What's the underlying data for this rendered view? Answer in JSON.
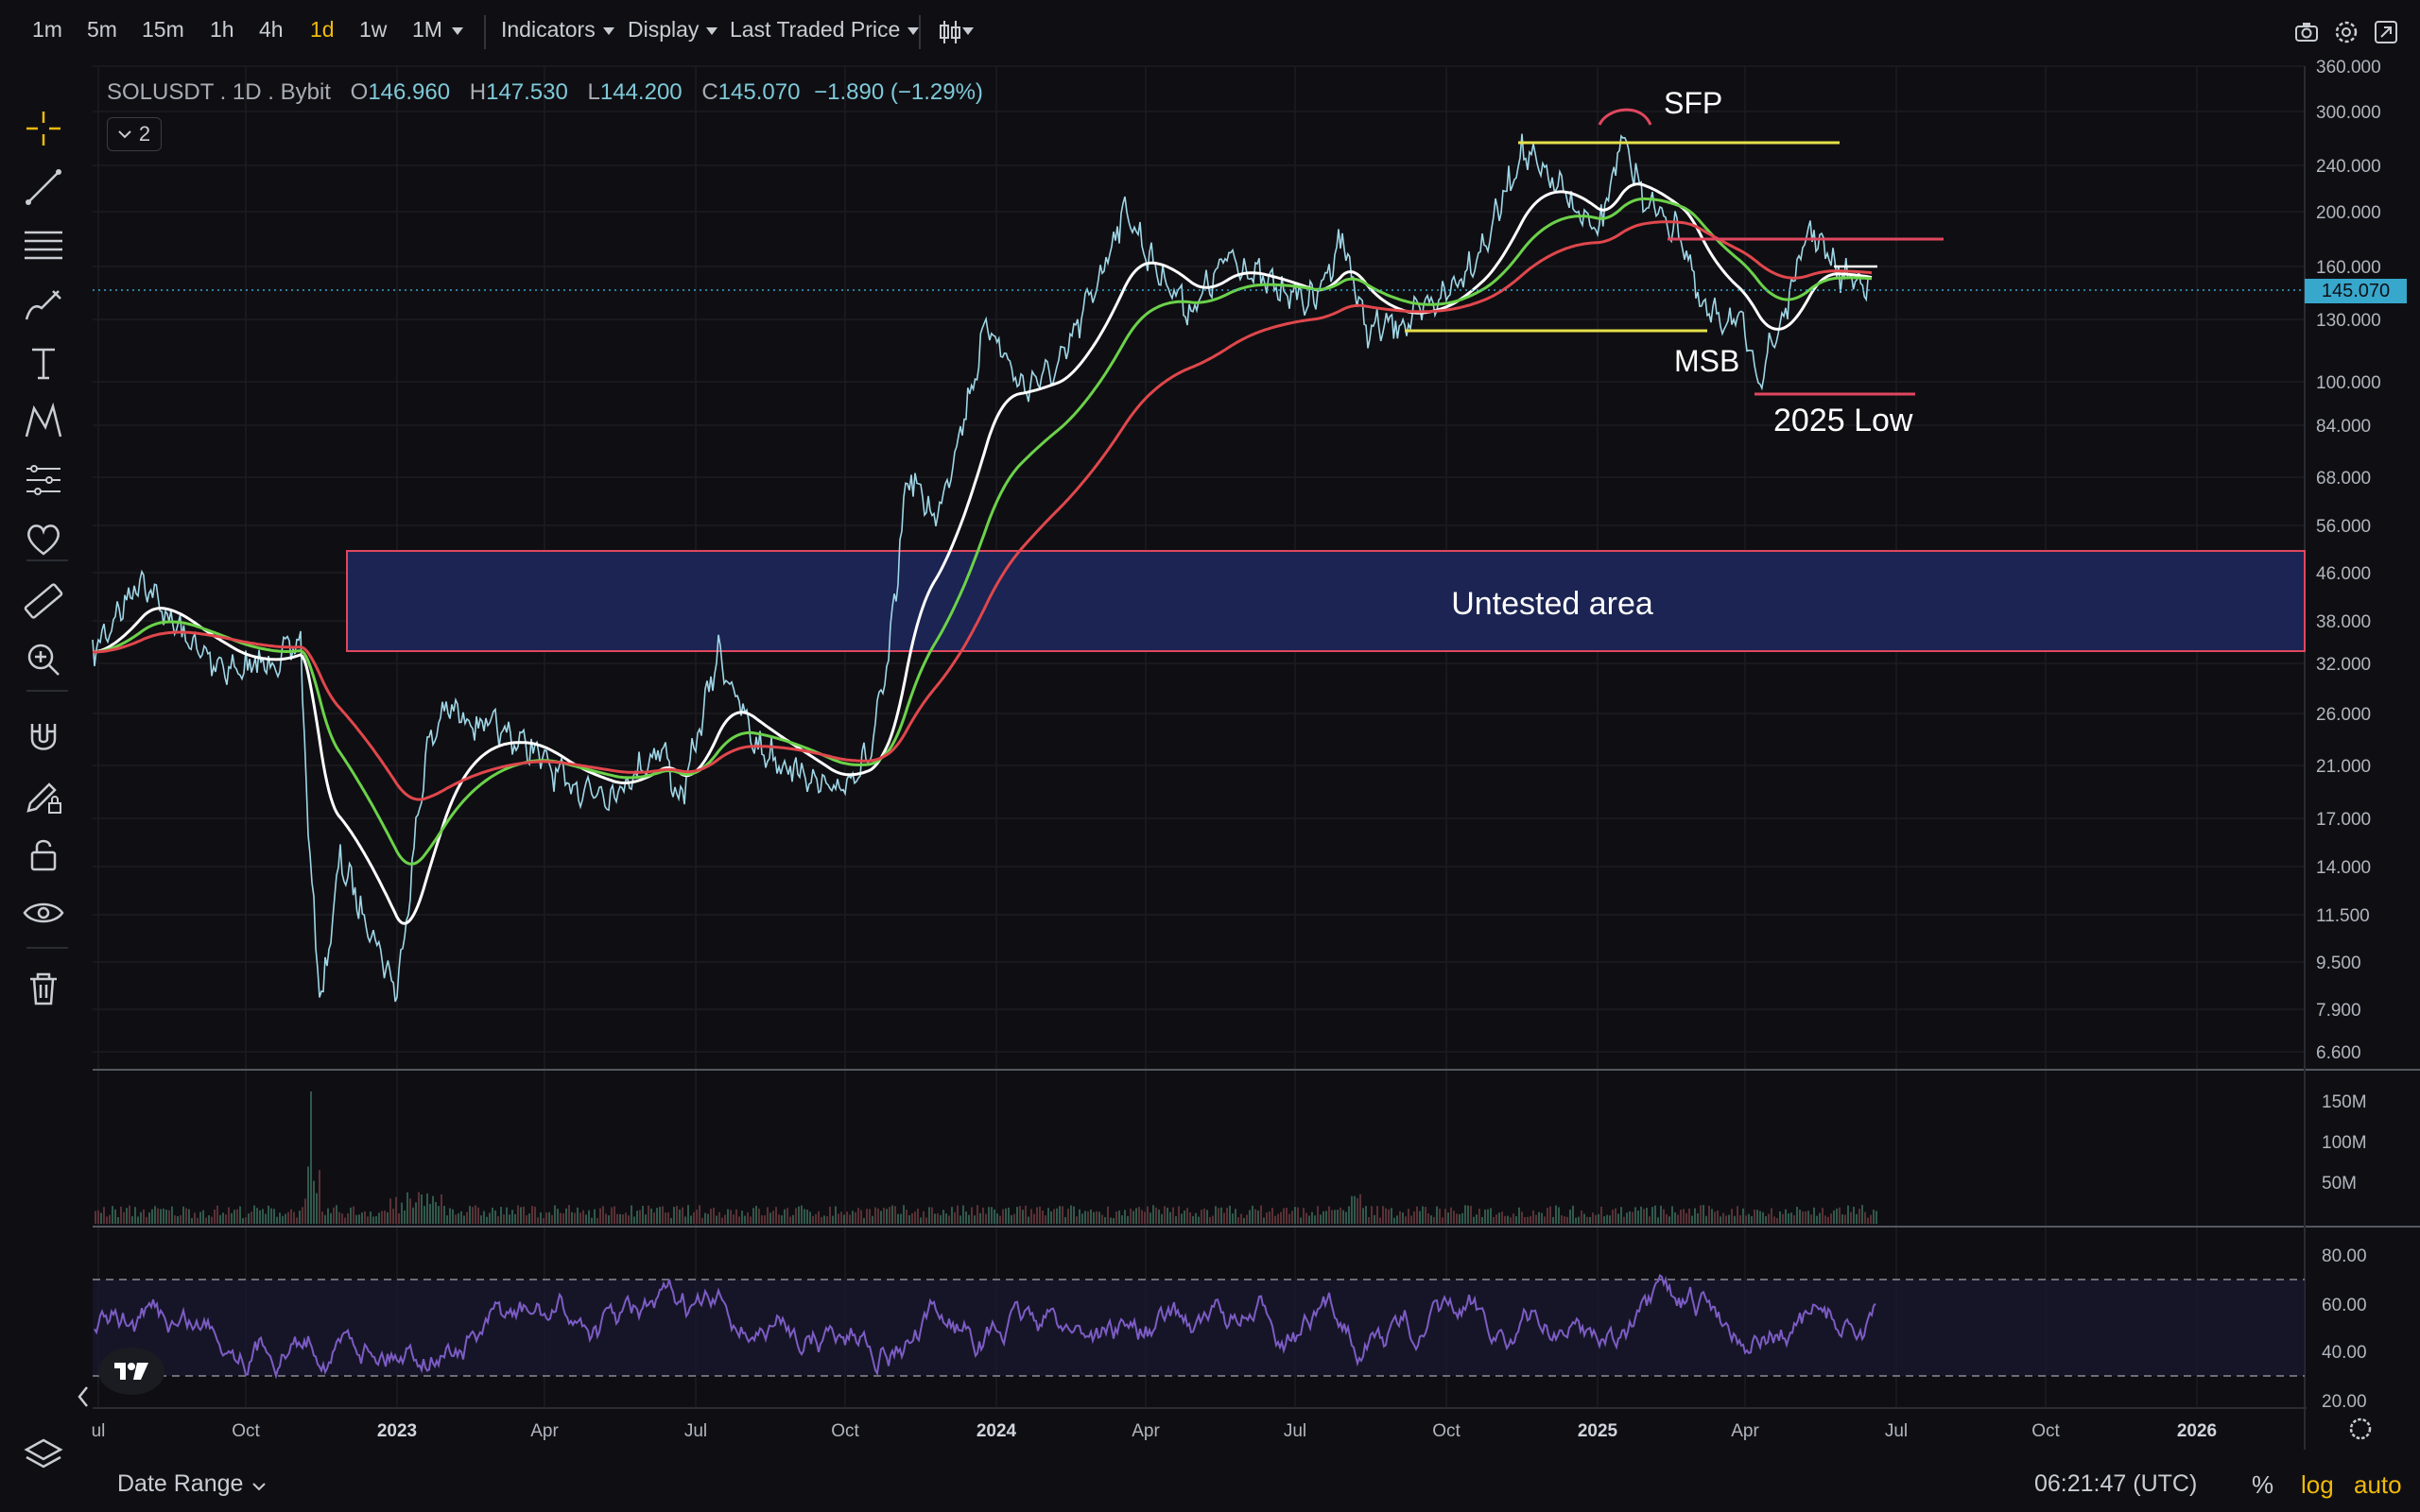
{
  "toolbar": {
    "timeframes": [
      "1m",
      "5m",
      "15m",
      "1h",
      "4h",
      "1d",
      "1w",
      "1M"
    ],
    "active_timeframe": "1d",
    "indicators_label": "Indicators",
    "display_label": "Display",
    "price_type_label": "Last Traded Price"
  },
  "legend": {
    "symbol": "SOLUSDT . 1D . Bybit",
    "open_label": "O",
    "open": "146.960",
    "high_label": "H",
    "high": "147.530",
    "low_label": "L",
    "low": "144.200",
    "close_label": "C",
    "close": "145.070",
    "change": "−1.890 (−1.29%)",
    "indicator_count": "2"
  },
  "last_price": "145.070",
  "price_axis": [
    "360.000",
    "300.000",
    "240.000",
    "200.000",
    "160.000",
    "130.000",
    "100.000",
    "84.000",
    "68.000",
    "56.000",
    "46.000",
    "38.000",
    "32.000",
    "26.000",
    "21.000",
    "17.000",
    "14.000",
    "11.500",
    "9.500",
    "7.900",
    "6.600"
  ],
  "volume_axis": [
    "150M",
    "100M",
    "50M"
  ],
  "rsi_axis": [
    "80.00",
    "60.00",
    "40.00",
    "20.00"
  ],
  "time_axis": [
    "ul",
    "Oct",
    "2023",
    "Apr",
    "Jul",
    "Oct",
    "2024",
    "Apr",
    "Jul",
    "Oct",
    "2025",
    "Apr",
    "Jul",
    "Oct",
    "2026"
  ],
  "annotations": {
    "sfp": "SFP",
    "msb": "MSB",
    "low_2025": "2025 Low",
    "untested_area": "Untested area"
  },
  "bottom": {
    "date_range_label": "Date Range",
    "clock": "06:21:47 (UTC)",
    "percent_label": "%",
    "log_label": "log",
    "auto_label": "auto"
  },
  "colors": {
    "price_line": "#9fd6e6",
    "ema_white": "#ffffff",
    "ema_green": "#6cd24a",
    "ema_red": "#e0474c",
    "rsi": "#7c5cc4",
    "zone_fill": "#1b2452",
    "zone_border": "#e0475f",
    "yellow_level": "#e6e04a",
    "accent_orange": "#f0b90b"
  },
  "icons": {
    "crosshair": "crosshair-icon",
    "trendline": "trend-line-icon",
    "fib": "fib-retracement-icon",
    "brush": "brush-icon",
    "text": "text-icon",
    "pattern": "pattern-icon",
    "measure-tools": "prediction-icon",
    "favorites": "heart-icon",
    "ruler": "ruler-icon",
    "zoom": "zoom-in-icon",
    "magnet": "magnet-icon",
    "lock-draw": "stay-in-drawing-mode-icon",
    "lock": "lock-icon",
    "visibility": "eye-icon",
    "trash": "trash-icon"
  }
}
